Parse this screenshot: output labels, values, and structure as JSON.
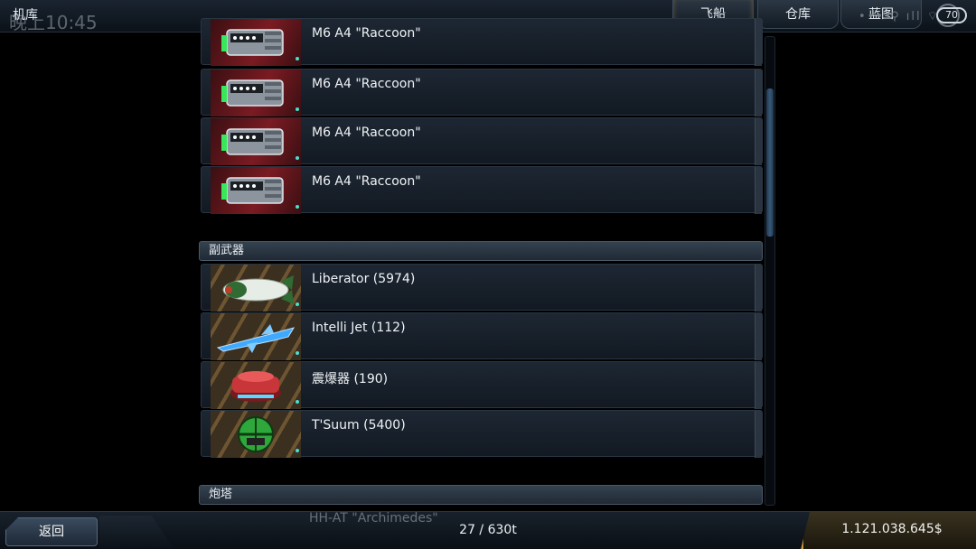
{
  "header": {
    "title": "机库",
    "status_time": "晚上10:45",
    "tabs": [
      {
        "label": "飞船",
        "active": true
      },
      {
        "label": "仓库",
        "active": false
      },
      {
        "label": "蓝图",
        "active": false
      }
    ],
    "status_icons": "••• ⚲ ıll ⌔",
    "battery": "70"
  },
  "sections": [
    {
      "items": [
        {
          "name": "M6 A4 \"Raccoon\"",
          "icon": "gatling-gun-icon"
        },
        {
          "name": "M6 A4 \"Raccoon\"",
          "icon": "gatling-gun-icon"
        },
        {
          "name": "M6 A4 \"Raccoon\"",
          "icon": "gatling-gun-icon"
        },
        {
          "name": "M6 A4 \"Raccoon\"",
          "icon": "gatling-gun-icon"
        }
      ]
    },
    {
      "title": "副武器",
      "items": [
        {
          "name": "Liberator (5974)",
          "icon": "missile-icon"
        },
        {
          "name": "Intelli Jet (112)",
          "icon": "blue-rocket-icon"
        },
        {
          "name": "震爆器 (190)",
          "icon": "red-mine-icon"
        },
        {
          "name": "T'Suum (5400)",
          "icon": "green-orb-icon"
        }
      ]
    },
    {
      "title": "炮塔",
      "items": [
        {
          "name": "HH-AT \"Archimedes\"",
          "icon": "turret-icon"
        }
      ]
    }
  ],
  "footer": {
    "back_label": "返回",
    "capacity": "27 / 630t",
    "credits": "1.121.038.645$"
  },
  "colors": {
    "accent_gold": "#d9a03a",
    "dot_cyan": "#49e0d0",
    "weapon_bg_red": "#7a1b22",
    "weapon_bg_amber": "#6e5532"
  }
}
